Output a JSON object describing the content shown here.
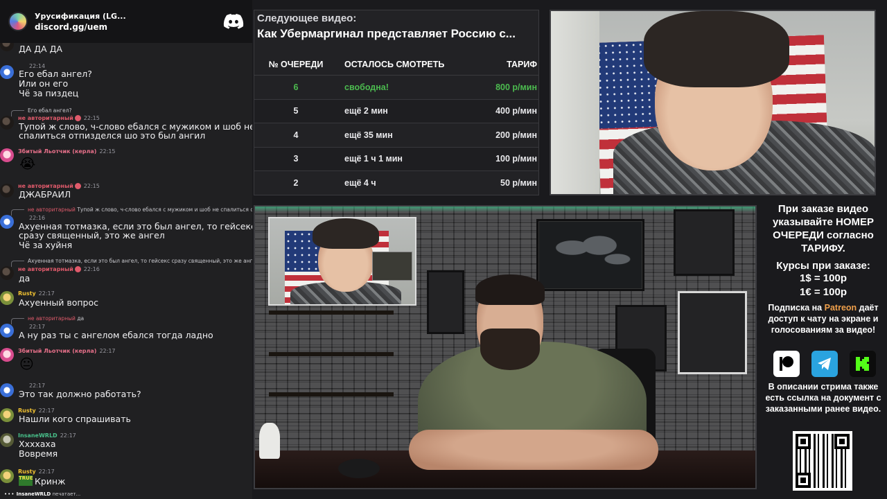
{
  "discord": {
    "server_name": "Урусификация (LG...",
    "invite": "discord.gg/uem"
  },
  "chat": {
    "msg0": {
      "text": "ДА ДА ДА"
    },
    "msg1": {
      "author": "",
      "time": "22:14",
      "lines": [
        "Его ебал ангел?",
        "Или он его",
        "Чё за пиздец"
      ]
    },
    "msg2": {
      "reply": "Его ебал ангел?",
      "author": "не авторитарный",
      "time": "22:15",
      "lines": [
        "Тупой ж слово, ч-слово ебался с мужиком и шоб не",
        "спалиться отпизделся шо это был ангил"
      ]
    },
    "msg3": {
      "author": "Збитый Льотчик (керла)",
      "time": "22:15",
      "emoji": "😭"
    },
    "msg4": {
      "author": "не авторитарный",
      "time": "22:15",
      "lines": [
        "ДЖАБРАИЛ"
      ]
    },
    "msg5": {
      "reply": "Тупой ж слово, ч-слово ебался с мужиком и шоб не спалиться отпизделся шо",
      "reply_author": "не авторитарный",
      "author": "",
      "time": "22:16",
      "lines": [
        "Ахуенная тотмазка, если это был ангел, то гейсекс",
        "сразу священный, это же ангел",
        "Чё за хуйня"
      ]
    },
    "msg6": {
      "reply": "Ахуенная тотмазка, если это был ангел, то гейсекс сразу священный, это же ангел",
      "author": "не авторитарный",
      "time": "22:16",
      "lines": [
        "да"
      ]
    },
    "msg7": {
      "author": "Rusty",
      "time": "22:17",
      "lines": [
        "Ахуенный вопрос"
      ]
    },
    "msg8": {
      "reply": "да",
      "reply_author": "не авторитарный",
      "author": "",
      "time": "22:17",
      "lines": [
        "А ну раз ты с ангелом ебался тогда ладно"
      ]
    },
    "msg9": {
      "author": "Збитый Льотчик (керла)",
      "time": "22:17",
      "emoji": "😐"
    },
    "msg10": {
      "author": "",
      "time": "22:17",
      "lines": [
        "Это так должно работать?"
      ]
    },
    "msg11": {
      "author": "Rusty",
      "time": "22:17",
      "lines": [
        "Нашли кого спрашивать"
      ]
    },
    "msg12": {
      "author": "InsaneWRLD",
      "time": "22:17",
      "lines": [
        "Ххххаха",
        "Вовремя"
      ]
    },
    "msg13": {
      "author": "Rusty",
      "time": "22:17",
      "badge": "TRUE",
      "lines": [
        "Кринж"
      ]
    },
    "typing": {
      "user": "InsaneWRLD",
      "text": "печатает..."
    }
  },
  "queue": {
    "caption": "Следующее видео:",
    "title": "Как Убермаргинал представляет Россию с...",
    "headers": [
      "№ ОЧЕРЕДИ",
      "ОСТАЛОСЬ СМОТРЕТЬ",
      "ТАРИФ"
    ],
    "rows": [
      {
        "n": "6",
        "left": "свободна!",
        "price": "800 р/мин",
        "free": true
      },
      {
        "n": "5",
        "left": "ещё 2 мин",
        "price": "400 р/мин"
      },
      {
        "n": "4",
        "left": "ещё 35 мин",
        "price": "200 р/мин"
      },
      {
        "n": "3",
        "left": "ещё 1 ч 1 мин",
        "price": "100 р/мин"
      },
      {
        "n": "2",
        "left": "ещё 4 ч",
        "price": "50 р/мин"
      }
    ],
    "free_color": "#4cbb4f"
  },
  "info": {
    "p1": "При заказе видео указывайте НОМЕР ОЧЕРЕДИ согласно ТАРИФУ.",
    "p2": "Курсы при заказе:",
    "p3": "1$ = 100р",
    "p4": "1€ = 100р",
    "sub_pre": "Подписка на",
    "sub_accent": "Patreon",
    "sub_post": "даёт доступ к чату на экране и голосованиям за видео!",
    "desc": "В описании стрима также есть ссылка на документ с заказанными ранее видео.",
    "accent_color": "#f0a04b",
    "icons": [
      "patreon-icon",
      "telegram-icon",
      "kick-icon"
    ]
  }
}
